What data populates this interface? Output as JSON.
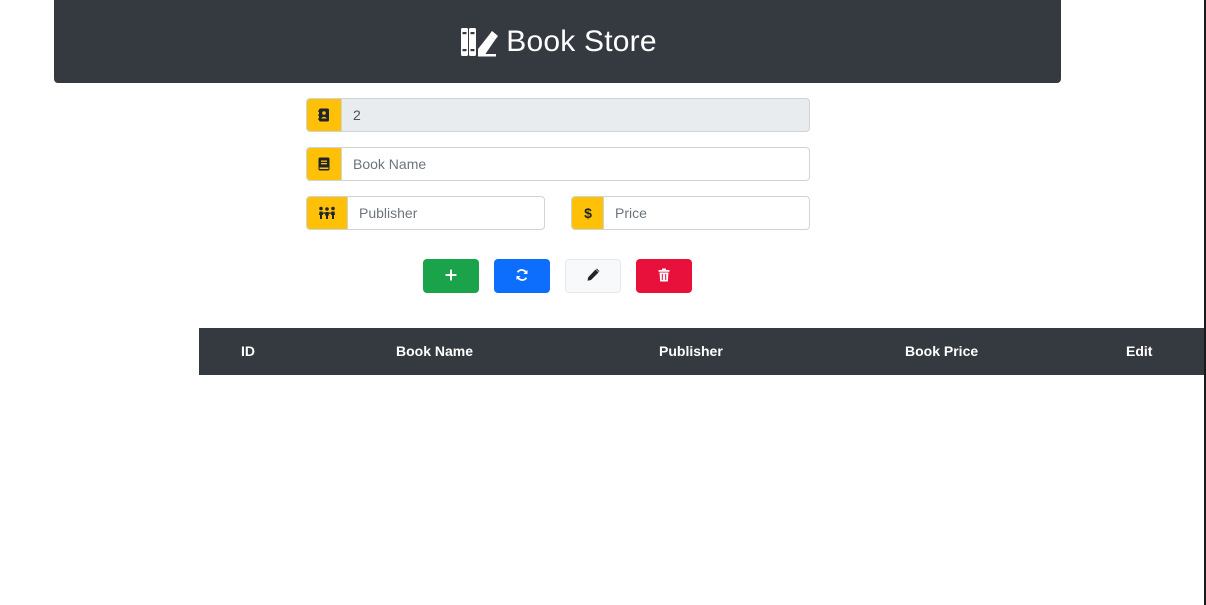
{
  "header": {
    "title": "Book Store",
    "background": "#343a40",
    "logo_icon": "book-store-icon"
  },
  "form": {
    "id_field": {
      "value": "2",
      "icon": "contact-book-icon",
      "readonly": true
    },
    "name_field": {
      "placeholder": "Book Name",
      "value": "",
      "icon": "book-icon"
    },
    "publisher_field": {
      "placeholder": "Publisher",
      "value": "",
      "icon": "people-icon"
    },
    "price_field": {
      "placeholder": "Price",
      "value": "",
      "icon": "dollar-icon"
    },
    "addon_color": "#ffc107"
  },
  "actions": {
    "add": {
      "icon": "plus-icon",
      "color": "#1aa34a"
    },
    "refresh": {
      "icon": "refresh-icon",
      "color": "#0d6efd"
    },
    "edit": {
      "icon": "pen-icon",
      "color": "#f8f9fa"
    },
    "delete": {
      "icon": "trash-icon",
      "color": "#e8113c"
    }
  },
  "table": {
    "columns": [
      "ID",
      "Book Name",
      "Publisher",
      "Book Price",
      "Edit"
    ],
    "rows": [],
    "header_background": "#343a40"
  }
}
